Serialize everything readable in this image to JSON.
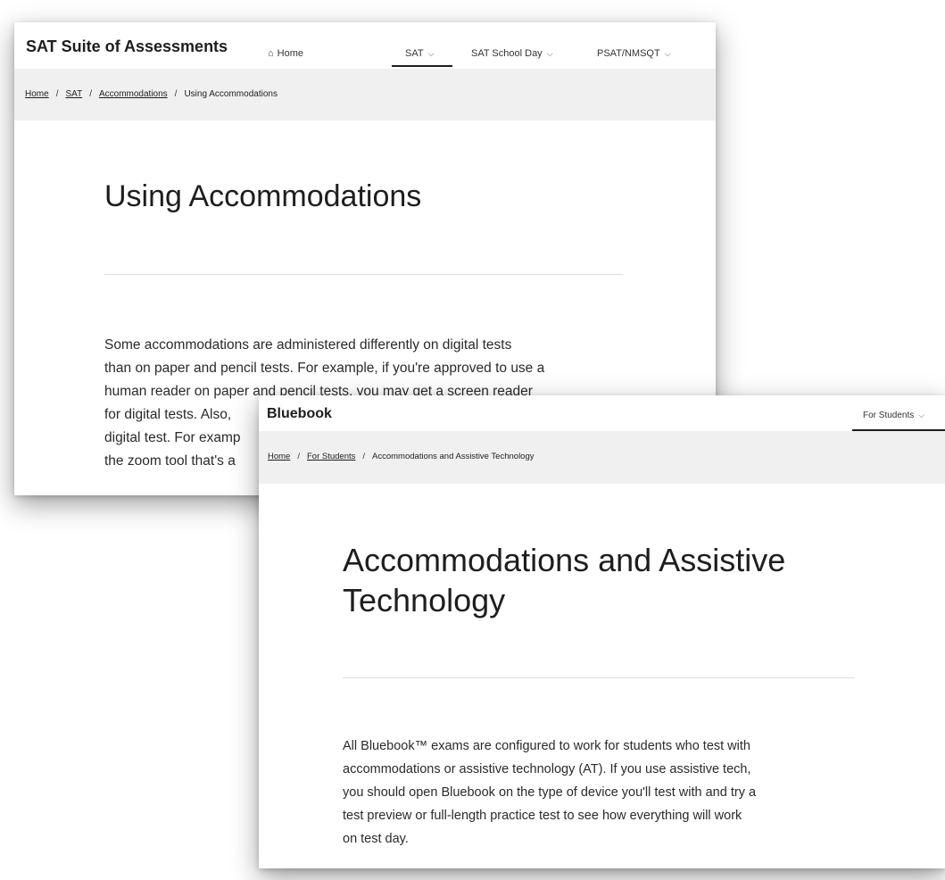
{
  "sat_window": {
    "brand": "SAT Suite of Assessments",
    "nav": {
      "home_icon": "house-icon",
      "home": "Home",
      "sat": "SAT",
      "sat_school_day": "SAT School Day",
      "psat": "PSAT/NMSQT",
      "dropdown_icon": "chevron-down-icon"
    },
    "breadcrumb": {
      "home": "Home",
      "sat": "SAT",
      "accommodations": "Accommodations",
      "current": "Using Accommodations",
      "separator": "/"
    },
    "title": "Using Accommodations",
    "body_lines": [
      "Some accommodations are administered differently on digital tests",
      "than on paper and pencil tests. For example, if you're approved to use a",
      "human reader on paper and pencil tests, you may get a screen reader",
      "for digital tests. Also,",
      "digital test. For examp",
      "the zoom tool that's a"
    ]
  },
  "bluebook_window": {
    "brand": "Bluebook",
    "nav": {
      "for_students": "For Students",
      "dropdown_icon": "chevron-down-icon"
    },
    "breadcrumb": {
      "home": "Home",
      "for_students": "For Students",
      "current": "Accommodations and Assistive Technology",
      "separator": "/"
    },
    "title_line1": "Accommodations and Assistive",
    "title_line2": "Technology",
    "body_lines": [
      "All Bluebook™ exams are configured to work for students who test with",
      "accommodations or assistive technology (AT). If you use assistive tech,",
      "you should open Bluebook on the type of device you'll test with and try a",
      "test preview or full-length practice test to see how everything will work",
      "on test day."
    ]
  }
}
